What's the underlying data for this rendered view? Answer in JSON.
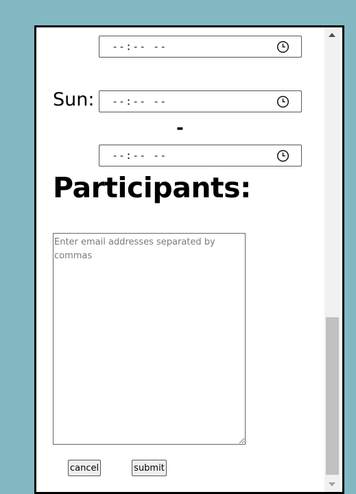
{
  "schedule": {
    "times": [
      {
        "value": "--:-- --"
      },
      {
        "value": "--:-- --"
      },
      {
        "value": "--:-- --"
      }
    ],
    "sun_label": "Sun:",
    "range_separator": "-"
  },
  "participants": {
    "title": "Participants:",
    "placeholder": "Enter email addresses separated by commas",
    "value": ""
  },
  "actions": {
    "cancel_label": "cancel",
    "submit_label": "submit"
  },
  "colors": {
    "background": "#83b8c2",
    "dialog_border": "#000000",
    "scrollbar_thumb": "#c1c1c1"
  },
  "icons": {
    "time_picker": "clock-icon",
    "scroll_up": "scroll-up-arrow-icon",
    "scroll_down": "scroll-down-arrow-icon"
  }
}
